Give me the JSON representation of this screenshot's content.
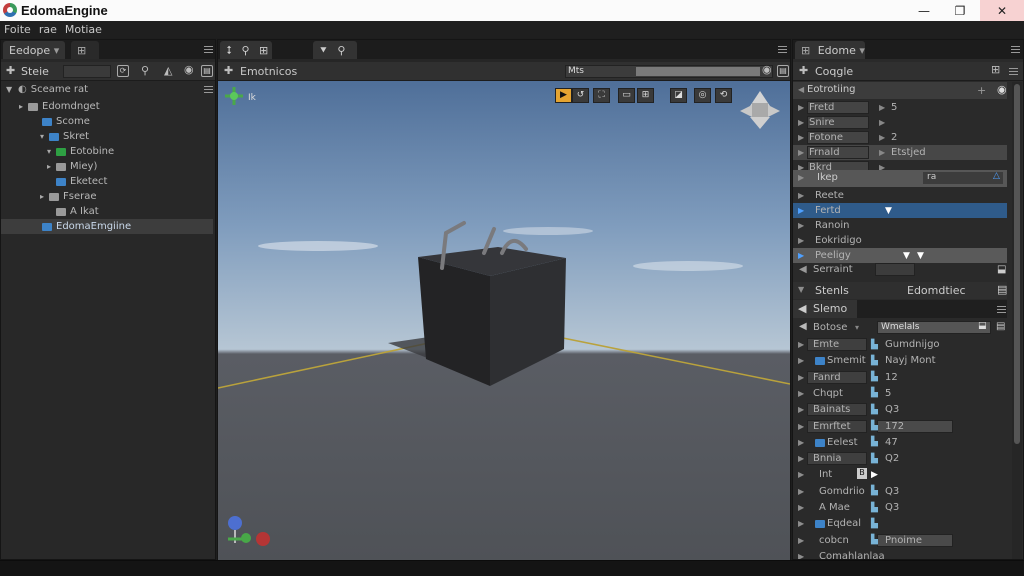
{
  "app": {
    "title": "EdomaEngine"
  },
  "window_controls": {
    "minimize": "—",
    "maximize": "❐",
    "close": "✕"
  },
  "menu": [
    "Foite",
    "rae",
    "Motiae"
  ],
  "left_tabs": {
    "tab1": "Eedope",
    "tab1_arrow": "▾"
  },
  "hierarchy": {
    "panel_title": "Steie",
    "root": "Sceame rat",
    "items": [
      {
        "label": "Edomdnget",
        "indent": 2,
        "arrow": "▸",
        "icon": "gray"
      },
      {
        "label": "Scome",
        "indent": 4,
        "arrow": "",
        "icon": "blue"
      },
      {
        "label": "Skret",
        "indent": 5,
        "arrow": "▾",
        "icon": "blue"
      },
      {
        "label": "Eotobine",
        "indent": 6,
        "arrow": "▾",
        "icon": "green"
      },
      {
        "label": "Miey)",
        "indent": 6,
        "arrow": "▸",
        "icon": "gray"
      },
      {
        "label": "Eketect",
        "indent": 6,
        "arrow": "",
        "icon": "blue"
      },
      {
        "label": "Fserae",
        "indent": 5,
        "arrow": "▸",
        "icon": "gray"
      },
      {
        "label": "A Ikat",
        "indent": 6,
        "arrow": "",
        "icon": "gray"
      },
      {
        "label": "EdomaEmgiine",
        "indent": 4,
        "arrow": "",
        "icon": "blue",
        "selected": true
      }
    ]
  },
  "scene": {
    "header_label": "Emotnicos",
    "search_label": "Mts",
    "corner_label": "Ik"
  },
  "inspector": {
    "tab": "Edome",
    "panel_title": "Coqgle",
    "section1_title": "Eotrotiing",
    "rows1": [
      {
        "label": "Fretd",
        "value": "5"
      },
      {
        "label": "Snire",
        "value": ""
      },
      {
        "label": "Fotone",
        "value": "2"
      },
      {
        "label": "Frnald",
        "value": "Etstjed"
      },
      {
        "label": "Bkrd",
        "value": ""
      }
    ],
    "sub_title": "Ikep",
    "sub_value": "rа",
    "rows2": [
      {
        "label": "Reete"
      },
      {
        "label": "Fertd"
      },
      {
        "label": "Ranoin"
      },
      {
        "label": "Eokridigo"
      },
      {
        "label": "Peeligy"
      }
    ],
    "scroll_label": "Serraint",
    "section2_left": "Stenls",
    "section2_right": "Edomdtiec",
    "scene_title": "Slemo",
    "filter_label": "Botose",
    "filter_value": "Wmelals",
    "rows3": [
      {
        "label": "Emte",
        "value": "Gumdnijgo"
      },
      {
        "label": "Smemit",
        "value": "Nayj Mont"
      },
      {
        "label": "Fanrd",
        "value": "12"
      },
      {
        "label": "Chqpt",
        "value": "5"
      },
      {
        "label": "Bainats",
        "value": "Q3"
      },
      {
        "label": "Emrftet",
        "value": "172"
      },
      {
        "label": "Eelest",
        "value": "47"
      },
      {
        "label": "Bnnia",
        "value": "Q2"
      },
      {
        "label": "Int",
        "value": ""
      },
      {
        "label": "Gomdriio",
        "value": "Q3"
      },
      {
        "label": "A Mae",
        "value": "Q3"
      },
      {
        "label": "Eqdeal",
        "value": ""
      },
      {
        "label": "cobcn",
        "value": "Pnoime"
      },
      {
        "label": "Comahlanlaa",
        "value": ""
      }
    ]
  }
}
